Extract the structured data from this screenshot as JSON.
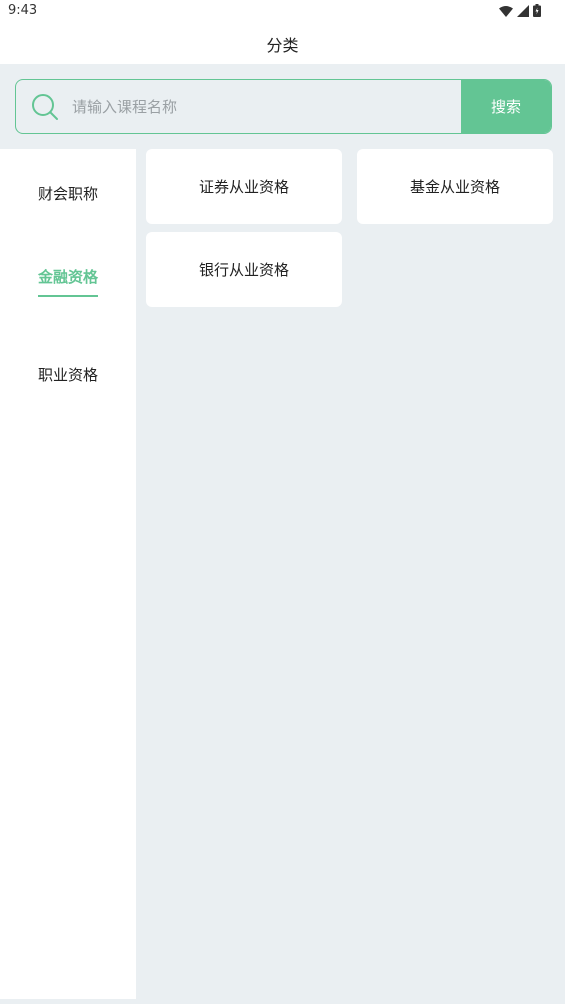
{
  "status_bar": {
    "time": "9:43",
    "icons": [
      "wifi-icon",
      "signal-icon",
      "battery-icon"
    ]
  },
  "header": {
    "title": "分类"
  },
  "search": {
    "placeholder": "请输入课程名称",
    "value": "",
    "button_label": "搜索"
  },
  "sidebar": {
    "items": [
      {
        "label": "财会职称",
        "active": false
      },
      {
        "label": "金融资格",
        "active": true
      },
      {
        "label": "职业资格",
        "active": false
      }
    ]
  },
  "content": {
    "cards": [
      {
        "label": "证券从业资格"
      },
      {
        "label": "基金从业资格"
      },
      {
        "label": "银行从业资格"
      }
    ]
  },
  "colors": {
    "accent": "#63c594",
    "background": "#eaeff2",
    "surface": "#ffffff",
    "text": "#222222",
    "placeholder": "#9aa0a4"
  }
}
